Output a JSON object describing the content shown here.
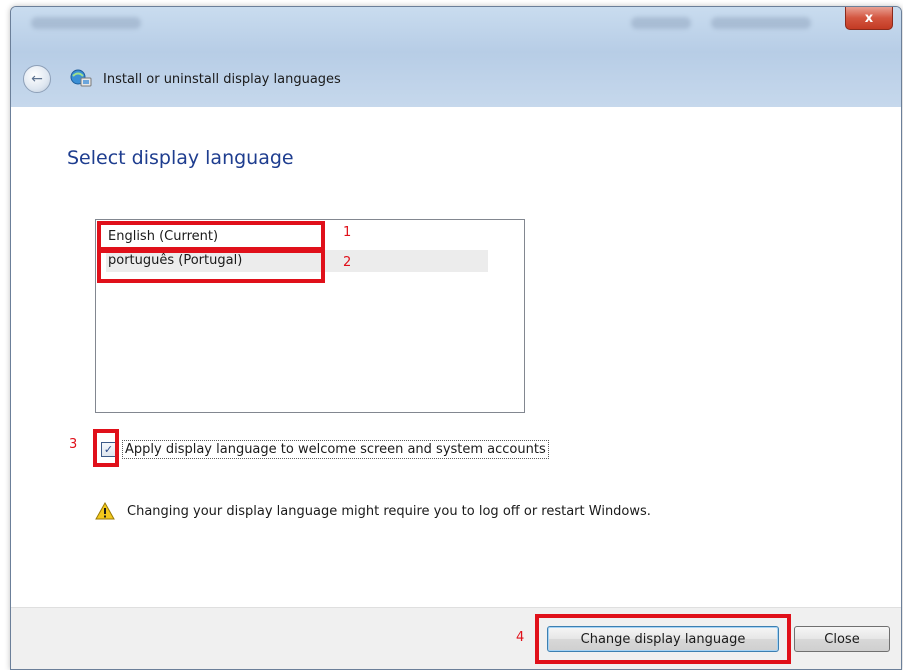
{
  "window": {
    "close_glyph": "x",
    "address_title": "Install or uninstall display languages"
  },
  "content": {
    "heading": "Select display language",
    "languages": [
      {
        "label": "English (Current)",
        "selected": false
      },
      {
        "label": "português (Portugal)",
        "selected": true
      }
    ],
    "apply_checkbox": {
      "label": "Apply display language to welcome screen and system accounts",
      "checked": true
    },
    "warning": "Changing your display language might require you to log off or restart Windows."
  },
  "footer": {
    "change_button": "Change display language",
    "close_button": "Close"
  },
  "annotations": {
    "n1": "1",
    "n2": "2",
    "n3": "3",
    "n4": "4",
    "color": "#e0101a"
  },
  "icons": {
    "back": "back-arrow-icon",
    "control_panel": "control-panel-icon",
    "warning": "warning-icon",
    "check": "checkmark-icon"
  }
}
